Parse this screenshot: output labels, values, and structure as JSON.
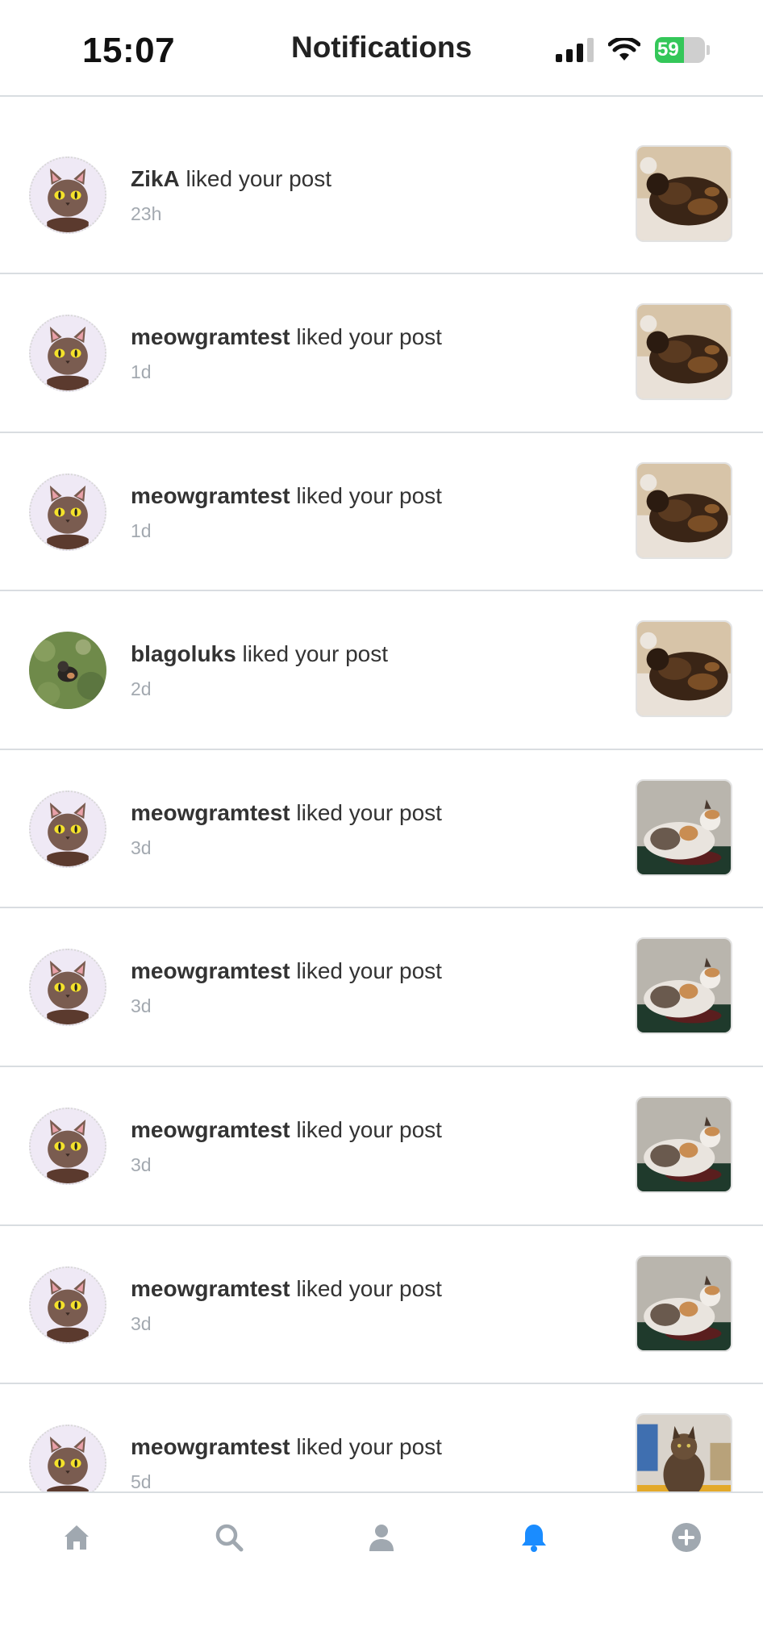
{
  "status_bar": {
    "time": "15:07",
    "battery": "59"
  },
  "header": {
    "title": "Notifications"
  },
  "notifications": [
    {
      "user": "ZikA",
      "action": " liked your post",
      "time": "23h",
      "avatar": "cat-icon",
      "post": "tortie-sleeping"
    },
    {
      "user": "meowgramtest",
      "action": " liked your post",
      "time": "1d",
      "avatar": "cat-icon",
      "post": "tortie-sleeping"
    },
    {
      "user": "meowgramtest",
      "action": " liked your post",
      "time": "1d",
      "avatar": "cat-icon",
      "post": "tortie-sleeping"
    },
    {
      "user": "blagoluks",
      "action": " liked your post",
      "time": "2d",
      "avatar": "kitten-photo",
      "post": "tortie-sleeping"
    },
    {
      "user": "meowgramtest",
      "action": " liked your post",
      "time": "3d",
      "avatar": "cat-icon",
      "post": "calico-lying"
    },
    {
      "user": "meowgramtest",
      "action": " liked your post",
      "time": "3d",
      "avatar": "cat-icon",
      "post": "calico-lying"
    },
    {
      "user": "meowgramtest",
      "action": " liked your post",
      "time": "3d",
      "avatar": "cat-icon",
      "post": "calico-lying"
    },
    {
      "user": "meowgramtest",
      "action": " liked your post",
      "time": "3d",
      "avatar": "cat-icon",
      "post": "calico-lying"
    },
    {
      "user": "meowgramtest",
      "action": " liked your post",
      "time": "5d",
      "avatar": "cat-icon",
      "post": "tabby-sitting"
    }
  ],
  "tabs": [
    {
      "name": "home",
      "icon": "home-icon",
      "active": false
    },
    {
      "name": "search",
      "icon": "search-icon",
      "active": false
    },
    {
      "name": "profile",
      "icon": "profile-icon",
      "active": false
    },
    {
      "name": "notifications",
      "icon": "bell-icon",
      "active": true
    },
    {
      "name": "add",
      "icon": "add-icon",
      "active": false
    }
  ],
  "colors": {
    "accent": "#1a8cff",
    "tab_inactive": "#a0a8b0",
    "divider": "#d9dde1",
    "battery": "#34c759"
  }
}
